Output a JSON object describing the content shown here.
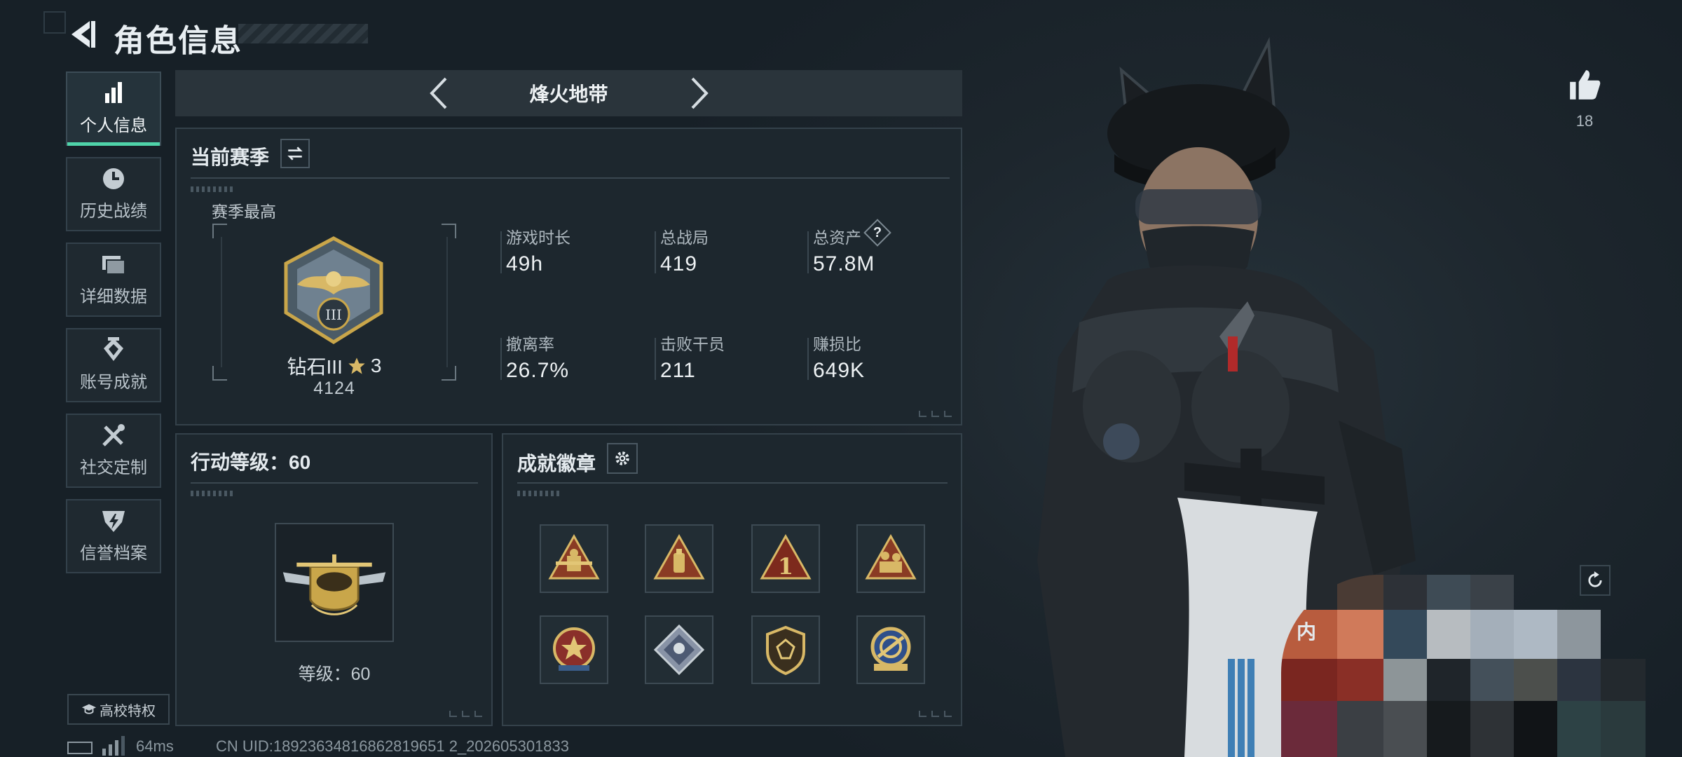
{
  "header": {
    "title": "角色信息"
  },
  "sidebar": {
    "items": [
      {
        "label": "个人信息",
        "icon": "bar-chart-icon",
        "active": true
      },
      {
        "label": "历史战绩",
        "icon": "clock-icon",
        "active": false
      },
      {
        "label": "详细数据",
        "icon": "folder-icon",
        "active": false
      },
      {
        "label": "账号成就",
        "icon": "medal-icon",
        "active": false
      },
      {
        "label": "社交定制",
        "icon": "tools-icon",
        "active": false
      },
      {
        "label": "信誉档案",
        "icon": "shield-icon",
        "active": false
      }
    ],
    "campus_label": "高校特权"
  },
  "mode": {
    "name": "烽火地带"
  },
  "season": {
    "title": "当前赛季",
    "best_label": "赛季最高",
    "rank_name": "钻石III",
    "stars": "3",
    "score": "4124",
    "stats": [
      {
        "label": "游戏时长",
        "value": "49h"
      },
      {
        "label": "总战局",
        "value": "419"
      },
      {
        "label": "总资产",
        "value": "57.8M",
        "help": "?"
      },
      {
        "label": "撤离率",
        "value": "26.7%"
      },
      {
        "label": "击败干员",
        "value": "211"
      },
      {
        "label": "赚损比",
        "value": "649K"
      }
    ]
  },
  "action_level": {
    "title": "行动等级：60",
    "level_text": "等级：60"
  },
  "achievements": {
    "title": "成就徽章",
    "badges": [
      "triangle-soldier-badge",
      "triangle-bottle-badge",
      "triangle-one-badge",
      "triangle-squad-badge",
      "round-star-badge",
      "diamond-gear-badge",
      "shield-emblem-badge",
      "round-gold-badge"
    ]
  },
  "character": {
    "likes": "18",
    "partial_text": "内"
  },
  "footer": {
    "ping": "64ms",
    "uid": "CN UID:18923634816862819651 2_202605301833"
  },
  "colors": {
    "accent": "#4fd3a9",
    "panel": "#1d272e",
    "border": "#34414a",
    "gold": "#c9a64a"
  }
}
